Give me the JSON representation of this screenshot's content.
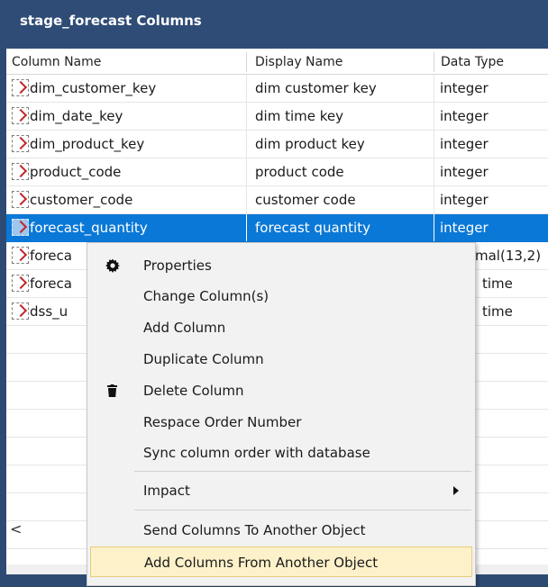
{
  "window": {
    "title": "stage_forecast Columns"
  },
  "table": {
    "headers": [
      "Column Name",
      "Display Name",
      "Data Type"
    ],
    "rows": [
      {
        "name": "dim_customer_key",
        "display": "dim customer key",
        "type": "integer"
      },
      {
        "name": "dim_date_key",
        "display": "dim time key",
        "type": "integer"
      },
      {
        "name": "dim_product_key",
        "display": "dim product key",
        "type": "integer"
      },
      {
        "name": "product_code",
        "display": "product code",
        "type": "integer"
      },
      {
        "name": "customer_code",
        "display": "customer code",
        "type": "integer"
      },
      {
        "name": "forecast_quantity",
        "display": "forecast quantity",
        "type": "integer",
        "selected": true
      },
      {
        "name": "foreca",
        "display": "",
        "type": "mal(13,2)"
      },
      {
        "name": "foreca",
        "display": "",
        "type": "time"
      },
      {
        "name": "dss_u",
        "display": "",
        "type": "time"
      }
    ],
    "scroll_left": "<"
  },
  "context_menu": {
    "items": [
      {
        "label": "Properties",
        "icon": "gear-icon"
      },
      {
        "label": "Change Column(s)"
      },
      {
        "label": "Add Column"
      },
      {
        "label": "Duplicate Column"
      },
      {
        "label": "Delete Column",
        "icon": "trash-icon"
      },
      {
        "label": "Respace Order Number"
      },
      {
        "label": "Sync column order with database"
      },
      {
        "label": "Impact",
        "submenu": true
      },
      {
        "label": "Send Columns To Another Object"
      },
      {
        "label": "Add Columns From Another Object",
        "highlighted": true
      }
    ]
  },
  "colors": {
    "title_bar": "#2f4c76",
    "selection": "#0a78d7",
    "menu_highlight": "#fcf1c9"
  }
}
